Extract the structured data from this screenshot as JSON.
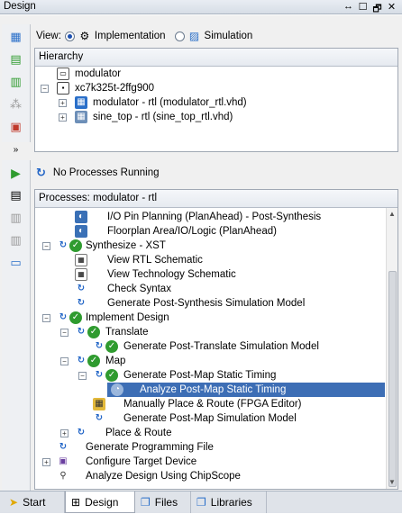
{
  "window": {
    "title": "Design",
    "controls": [
      "↔",
      "☐",
      "🗗",
      "✕"
    ]
  },
  "viewbar": {
    "label": "View:",
    "implementation": "Implementation",
    "simulation": "Simulation"
  },
  "hierarchy": {
    "header": "Hierarchy",
    "items": [
      {
        "label": "modulator"
      },
      {
        "label": "xc7k325t-2ffg900"
      },
      {
        "label": "modulator - rtl (modulator_rtl.vhd)"
      },
      {
        "label": "sine_top - rtl (sine_top_rtl.vhd)"
      }
    ]
  },
  "process_status": "No Processes Running",
  "processes": {
    "header": "Processes: modulator - rtl",
    "items": [
      {
        "label": "I/O Pin Planning (PlanAhead) - Post-Synthesis"
      },
      {
        "label": "Floorplan Area/IO/Logic (PlanAhead)"
      },
      {
        "label": "Synthesize - XST"
      },
      {
        "label": "View RTL Schematic"
      },
      {
        "label": "View Technology Schematic"
      },
      {
        "label": "Check Syntax"
      },
      {
        "label": "Generate Post-Synthesis Simulation Model"
      },
      {
        "label": "Implement Design"
      },
      {
        "label": "Translate"
      },
      {
        "label": "Generate Post-Translate Simulation Model"
      },
      {
        "label": "Map"
      },
      {
        "label": "Generate Post-Map Static Timing"
      },
      {
        "label": "Analyze Post-Map Static Timing"
      },
      {
        "label": "Manually Place & Route (FPGA Editor)"
      },
      {
        "label": "Generate Post-Map Simulation Model"
      },
      {
        "label": "Place & Route"
      },
      {
        "label": "Generate Programming File"
      },
      {
        "label": "Configure Target Device"
      },
      {
        "label": "Analyze Design Using ChipScope"
      }
    ]
  },
  "tabs": [
    "Start",
    "Design",
    "Files",
    "Libraries"
  ],
  "colors": {
    "selection": "#3d6eb5",
    "status_ok": "#2f9b2f"
  }
}
